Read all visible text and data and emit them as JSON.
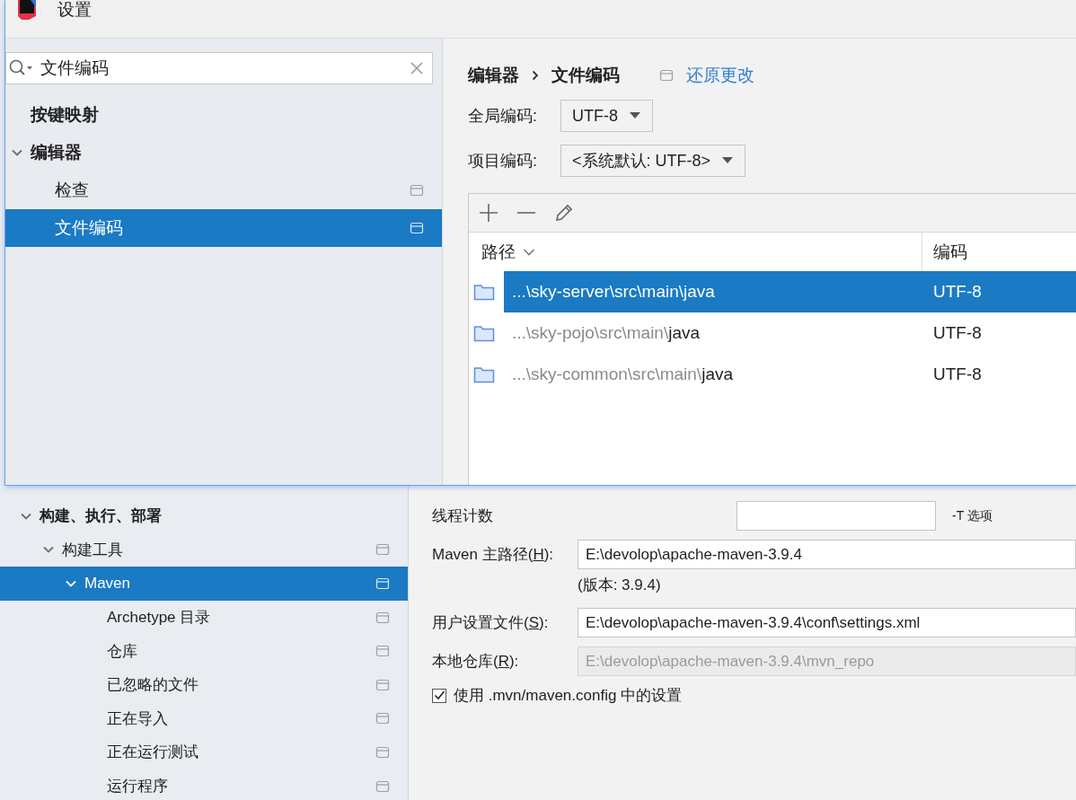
{
  "back_window": {
    "tree": [
      {
        "label": "构建、执行、部署",
        "bold": true,
        "expanded": true,
        "selected": false,
        "project_icon": false,
        "children": [
          {
            "label": "构建工具",
            "bold": false,
            "expanded": true,
            "selected": false,
            "project_icon": true,
            "children": [
              {
                "label": "Maven",
                "bold": false,
                "expanded": true,
                "selected": true,
                "project_icon": true,
                "children": [
                  {
                    "label": "Archetype 目录",
                    "bold": false,
                    "selected": false,
                    "project_icon": true
                  },
                  {
                    "label": "仓库",
                    "bold": false,
                    "selected": false,
                    "project_icon": true
                  },
                  {
                    "label": "已忽略的文件",
                    "bold": false,
                    "selected": false,
                    "project_icon": true
                  },
                  {
                    "label": "正在导入",
                    "bold": false,
                    "selected": false,
                    "project_icon": true
                  },
                  {
                    "label": "正在运行测试",
                    "bold": false,
                    "selected": false,
                    "project_icon": true
                  },
                  {
                    "label": "运行程序",
                    "bold": false,
                    "selected": false,
                    "project_icon": true
                  }
                ]
              }
            ]
          }
        ]
      }
    ],
    "form": [
      {
        "kind": "short_field",
        "label": [
          "线程计数"
        ],
        "note": "-T 选项",
        "disabled": false
      },
      {
        "kind": "field",
        "label": [
          "Maven 主路径(",
          "H",
          "):"
        ],
        "value": "E:\\devolop\\apache-maven-3.9.4",
        "disabled": false
      },
      {
        "kind": "note",
        "text": "(版本: 3.9.4)"
      },
      {
        "kind": "field",
        "label": [
          "用户设置文件(",
          "S",
          "):"
        ],
        "value": "E:\\devolop\\apache-maven-3.9.4\\conf\\settings.xml",
        "disabled": false
      },
      {
        "kind": "field",
        "label": [
          "本地仓库(",
          "R",
          "):"
        ],
        "value": "E:\\devolop\\apache-maven-3.9.4\\mvn_repo",
        "disabled": true
      },
      {
        "kind": "checkbox",
        "label": "使用 .mvn/maven.config 中的设置",
        "checked": true
      }
    ]
  },
  "front_window": {
    "title": "设置",
    "search": {
      "value": "文件编码"
    },
    "tree": [
      {
        "label": "按键映射",
        "bold": true,
        "selected": false,
        "project_icon": false
      },
      {
        "label": "编辑器",
        "bold": true,
        "expanded": true,
        "selected": false,
        "project_icon": false,
        "children": [
          {
            "label": "检查",
            "bold": false,
            "selected": false,
            "project_icon": true
          },
          {
            "label": "文件编码",
            "bold": false,
            "selected": true,
            "project_icon": true
          }
        ]
      }
    ],
    "breadcrumb": [
      "编辑器",
      "文件编码"
    ],
    "reset_link": "还原更改",
    "global_encoding": {
      "label": "全局编码:",
      "value": "UTF-8"
    },
    "project_encoding": {
      "label": "项目编码:",
      "value": "<系统默认: UTF-8>"
    },
    "table": {
      "columns": [
        "路径",
        "编码"
      ],
      "rows": [
        {
          "path_dim": "...\\sky-server\\src\\main\\",
          "path_name": "java",
          "encoding": "UTF-8",
          "selected": true
        },
        {
          "path_dim": "...\\sky-pojo\\src\\main\\",
          "path_name": "java",
          "encoding": "UTF-8",
          "selected": false
        },
        {
          "path_dim": "...\\sky-common\\src\\main\\",
          "path_name": "java",
          "encoding": "UTF-8",
          "selected": false
        }
      ]
    }
  }
}
